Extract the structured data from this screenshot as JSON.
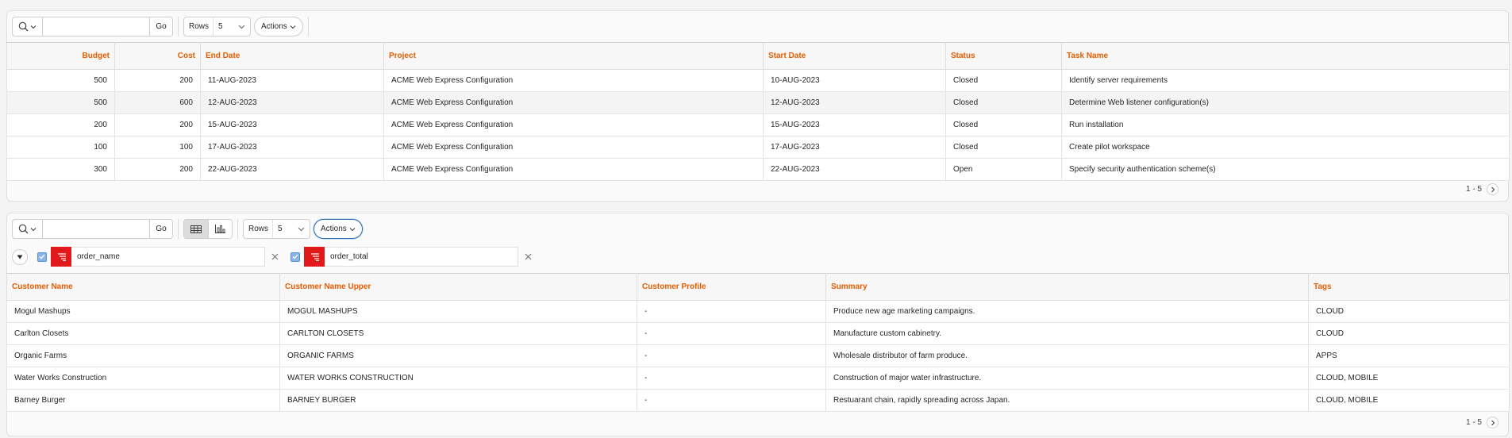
{
  "report1": {
    "search": {
      "value": "",
      "placeholder": "",
      "icon": "search-icon",
      "go_label": "Go"
    },
    "rows": {
      "label": "Rows",
      "value": "5"
    },
    "actions_label": "Actions",
    "columns": [
      "Budget",
      "Cost",
      "End Date",
      "Project",
      "Start Date",
      "Status",
      "Task Name"
    ],
    "rows_data": [
      [
        "500",
        "200",
        "11-AUG-2023",
        "ACME Web Express Configuration",
        "10-AUG-2023",
        "Closed",
        "Identify server requirements"
      ],
      [
        "500",
        "600",
        "12-AUG-2023",
        "ACME Web Express Configuration",
        "12-AUG-2023",
        "Closed",
        "Determine Web listener configuration(s)"
      ],
      [
        "200",
        "200",
        "15-AUG-2023",
        "ACME Web Express Configuration",
        "15-AUG-2023",
        "Closed",
        "Run installation"
      ],
      [
        "100",
        "100",
        "17-AUG-2023",
        "ACME Web Express Configuration",
        "17-AUG-2023",
        "Closed",
        "Create pilot workspace"
      ],
      [
        "300",
        "200",
        "22-AUG-2023",
        "ACME Web Express Configuration",
        "22-AUG-2023",
        "Open",
        "Specify security authentication scheme(s)"
      ]
    ],
    "pagination": "1 - 5"
  },
  "report2": {
    "search": {
      "value": "",
      "placeholder": "",
      "icon": "search-icon",
      "go_label": "Go"
    },
    "views": [
      "grid-view-icon",
      "chart-view-icon"
    ],
    "rows": {
      "label": "Rows",
      "value": "5"
    },
    "actions_label": "Actions",
    "filters": [
      {
        "label": "order_name",
        "checked": true
      },
      {
        "label": "order_total",
        "checked": true
      }
    ],
    "columns": [
      "Customer Name",
      "Customer Name Upper",
      "Customer Profile",
      "Summary",
      "Tags"
    ],
    "rows_data": [
      [
        "Mogul Mashups",
        "MOGUL MASHUPS",
        "-",
        "Produce new age marketing campaigns.",
        "CLOUD"
      ],
      [
        "Carlton Closets",
        "CARLTON CLOSETS",
        "-",
        "Manufacture custom cabinetry.",
        "CLOUD"
      ],
      [
        "Organic Farms",
        "ORGANIC FARMS",
        "-",
        "Wholesale distributor of farm produce.",
        "APPS"
      ],
      [
        "Water Works Construction",
        "WATER WORKS CONSTRUCTION",
        "-",
        "Construction of major water infrastructure.",
        "CLOUD, MOBILE"
      ],
      [
        "Barney Burger",
        "BARNEY BURGER",
        "-",
        "Restuarant chain, rapidly spreading across Japan.",
        "CLOUD, MOBILE"
      ]
    ],
    "pagination": "1 - 5"
  },
  "colors": {
    "header_text": "#e35d00",
    "filter_badge": "#e2191a",
    "focus_ring": "#2b68b0"
  }
}
